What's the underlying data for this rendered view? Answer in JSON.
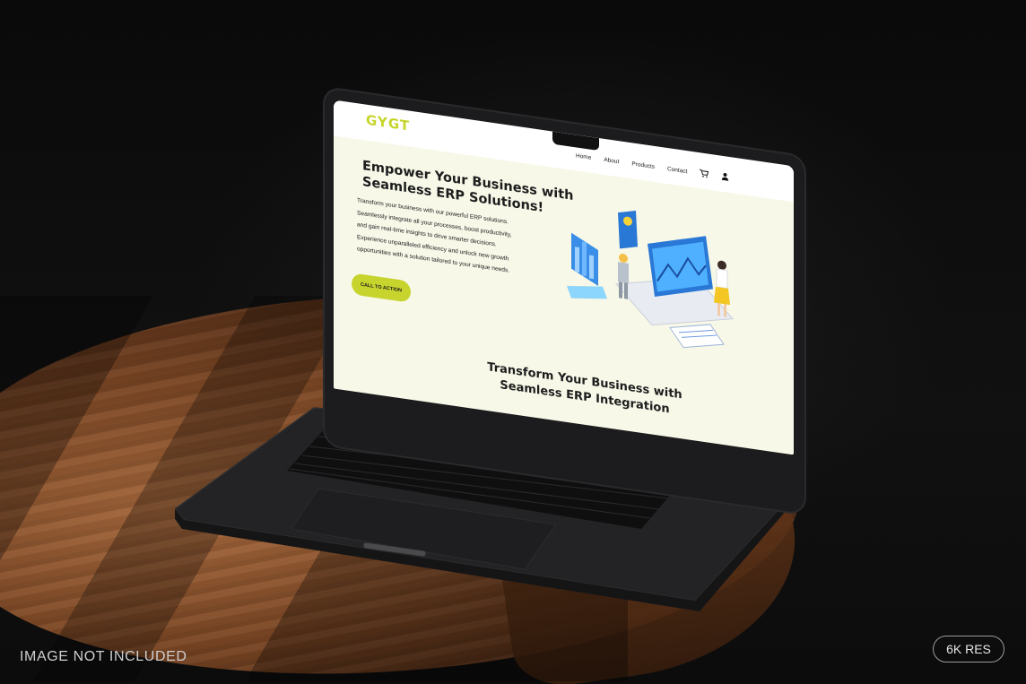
{
  "website": {
    "logo_text": "GYGT",
    "nav": {
      "home": "Home",
      "about": "About",
      "products": "Products",
      "contact": "Contact"
    },
    "icons": {
      "cart": "cart-icon",
      "user": "user-icon"
    },
    "hero": {
      "title_line1": "Empower Your Business with",
      "title_line2": "Seamless ERP Solutions!",
      "body_lines": [
        "Transform your business with our powerful ERP solutions.",
        "Seamlessly integrate all your processes, boost productivity,",
        "and gain real-time insights to drive smarter decisions.",
        "Experience unparalleled efficiency and unlock new growth",
        "opportunities with a solution tailored to your unique needs."
      ],
      "cta_label": "CALL TO ACTION"
    },
    "section": {
      "title_line1": "Transform Your Business with",
      "title_line2": "Seamless ERP Integration"
    }
  },
  "overlay": {
    "left_caption": "IMAGE NOT INCLUDED",
    "right_badge": "6K RES"
  },
  "colors": {
    "accent": "#c8d42e",
    "screen_bg": "#f7f8e8",
    "laptop_body": "#1c1c1e",
    "wood": "#7a4624"
  }
}
